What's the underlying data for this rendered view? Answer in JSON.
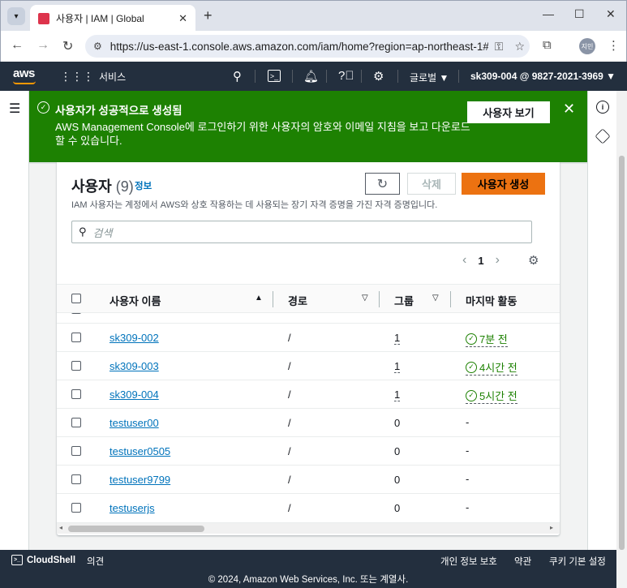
{
  "browser": {
    "tab_title": "사용자 | IAM | Global",
    "favicon_text": "IAM",
    "url": "https://us-east-1.console.aws.amazon.com/iam/home?region=ap-northeast-1#/...",
    "profile_initials": "지민"
  },
  "aws_nav": {
    "logo": "aws",
    "services_label": "서비스",
    "region_label": "글로벌 ▼",
    "account_label": "sk309-004 @ 9827-2021-3969 ▼"
  },
  "flash": {
    "title": "사용자가 성공적으로 생성됨",
    "body": "AWS Management Console에 로그인하기 위한 사용자의 암호와 이메일 지침을 보고 다운로드할 수 있습니다.",
    "view_button": "사용자 보기",
    "color": "#1d8102"
  },
  "users_panel": {
    "title": "사용자",
    "count": "(9)",
    "info_link": "정보",
    "description": "IAM 사용자는 계정에서 AWS와 상호 작용하는 데 사용되는 장기 자격 증명을 가진 자격 증명입니다.",
    "delete_button": "삭제",
    "create_button": "사용자 생성",
    "search_placeholder": "검색",
    "page_number": "1",
    "columns": {
      "name": "사용자 이름",
      "path": "경로",
      "groups": "그룹",
      "last_activity": "마지막 활동"
    },
    "rows": [
      {
        "name": "sk309-002",
        "path": "/",
        "groups": "1",
        "activity": "7분 전",
        "active": true
      },
      {
        "name": "sk309-003",
        "path": "/",
        "groups": "1",
        "activity": "4시간 전",
        "active": true
      },
      {
        "name": "sk309-004",
        "path": "/",
        "groups": "1",
        "activity": "5시간 전",
        "active": true
      },
      {
        "name": "testuser00",
        "path": "/",
        "groups": "0",
        "activity": "-",
        "active": false
      },
      {
        "name": "testuser0505",
        "path": "/",
        "groups": "0",
        "activity": "-",
        "active": false
      },
      {
        "name": "testuser9799",
        "path": "/",
        "groups": "0",
        "activity": "-",
        "active": false
      },
      {
        "name": "testuserjs",
        "path": "/",
        "groups": "0",
        "activity": "-",
        "active": false
      }
    ]
  },
  "footer": {
    "cloudshell": "CloudShell",
    "feedback": "의견",
    "privacy": "개인 정보 보호",
    "terms": "약관",
    "cookies": "쿠키 기본 설정",
    "copyright": "© 2024, Amazon Web Services, Inc. 또는 계열사."
  },
  "colors": {
    "aws_nav_bg": "#232f3e",
    "primary_button": "#ec7211",
    "link": "#0073bb",
    "success": "#1d8102"
  }
}
